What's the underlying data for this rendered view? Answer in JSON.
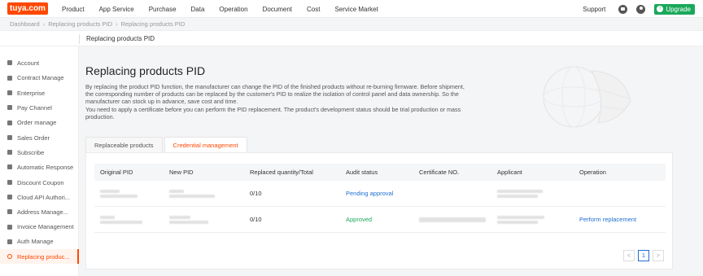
{
  "topnav": {
    "logo": "tuya.com",
    "items": [
      "Product",
      "App Service",
      "Purchase",
      "Data",
      "Operation",
      "Document",
      "Cost",
      "Service Market"
    ],
    "support": "Support",
    "upgrade": "Upgrade"
  },
  "breadcrumb": [
    "Dashboard",
    "Replacing products PID",
    "Replacing products PID"
  ],
  "titlebar": "Replacing products PID",
  "sidebar": {
    "items": [
      {
        "label": "Account",
        "icon": "user-icon"
      },
      {
        "label": "Contract Manage",
        "icon": "contract-icon"
      },
      {
        "label": "Enterprise",
        "icon": "enterprise-icon"
      },
      {
        "label": "Pay Channel",
        "icon": "pay-icon"
      },
      {
        "label": "Order manage",
        "icon": "order-icon"
      },
      {
        "label": "Sales Order",
        "icon": "sales-order-icon"
      },
      {
        "label": "Subscribe",
        "icon": "subscribe-icon"
      },
      {
        "label": "Automatic Response",
        "icon": "auto-response-icon"
      },
      {
        "label": "Discount Coupon",
        "icon": "coupon-icon"
      },
      {
        "label": "Cloud API Authori...",
        "icon": "cloud-icon"
      },
      {
        "label": "Address Manage...",
        "icon": "address-icon"
      },
      {
        "label": "Invoice Management",
        "icon": "invoice-icon"
      },
      {
        "label": "Auth Manage",
        "icon": "auth-icon"
      },
      {
        "label": "Replacing produc...",
        "icon": "replace-icon",
        "active": true
      }
    ]
  },
  "main": {
    "title": "Replacing products PID",
    "description": "By replacing the product PID function, the manufacturer can change the PID of the finished products without re-burning firmware. Before shipment, the corresponding number of products can be replaced by the customer's PID to realize the isolation of control panel and data ownership. So the manufacturer can stock up in advance, save cost and time.\nYou need to apply a certificate before you can perform the PID replacement. The product's development status should be trial production or mass production.",
    "tabs": [
      {
        "label": "Replaceable products",
        "active": false
      },
      {
        "label": "Credential management",
        "active": true
      }
    ],
    "table": {
      "headers": [
        "Original PID",
        "New PID",
        "Replaced quantity/Total",
        "Audit status",
        "Certificate NO.",
        "Applicant",
        "Operation"
      ],
      "rows": [
        {
          "quantity": "0/10",
          "status": "Pending approval",
          "status_color": "#1f6fd1",
          "operation": ""
        },
        {
          "quantity": "0/10",
          "status": "Approved",
          "status_color": "#1aa85a",
          "operation": "Perform replacement"
        }
      ]
    },
    "pagination": {
      "prev": "<",
      "current": "1",
      "next": ">"
    }
  },
  "colors": {
    "brand": "#ff4800",
    "link": "#1f6fd1",
    "success": "#1aa85a"
  }
}
